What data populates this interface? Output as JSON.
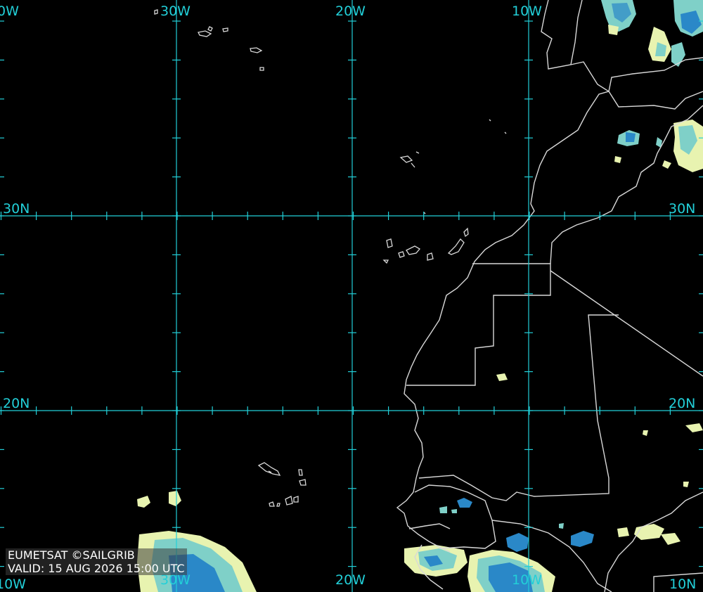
{
  "map": {
    "type": "satellite-infrared-image",
    "colors": {
      "background": "#000000",
      "graticule": "#22cfd8",
      "coastline": "#d8d8d8",
      "cloud_low": "#e8f3b0",
      "cloud_mid": "#7fd0c8",
      "cloud_high": "#2a88c8"
    },
    "longitude_labels": {
      "top": [
        "0W",
        "30W",
        "20W",
        "10W"
      ],
      "bottom": [
        "10W",
        "30W",
        "20W",
        "10W",
        "10N"
      ]
    },
    "latitude_labels": {
      "left": [
        "30N",
        "20N"
      ],
      "right": [
        "30N",
        "20N"
      ]
    }
  },
  "credit": {
    "line1": "EUMETSAT ©SAILGRIB",
    "line2": "VALID:  15 AUG 2026 15:00 UTC"
  }
}
